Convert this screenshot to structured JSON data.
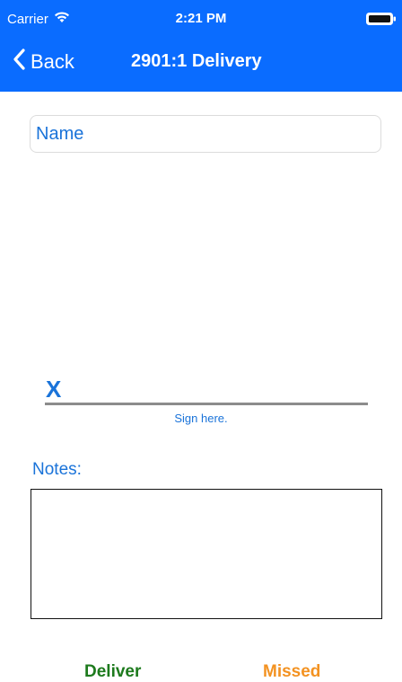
{
  "status_bar": {
    "carrier": "Carrier",
    "time": "2:21 PM",
    "icons": [
      "wifi-icon",
      "battery-icon"
    ]
  },
  "nav": {
    "back_label": "Back",
    "title": "2901:1 Delivery"
  },
  "form": {
    "name_placeholder": "Name",
    "signature_mark": "X",
    "signature_caption": "Sign here.",
    "notes_label": "Notes:",
    "notes_value": ""
  },
  "actions": {
    "deliver_label": "Deliver",
    "missed_label": "Missed"
  },
  "colors": {
    "bar": "#0a6cff",
    "accent_text": "#1a73d9",
    "deliver": "#1d7a1d",
    "missed": "#f39221"
  }
}
